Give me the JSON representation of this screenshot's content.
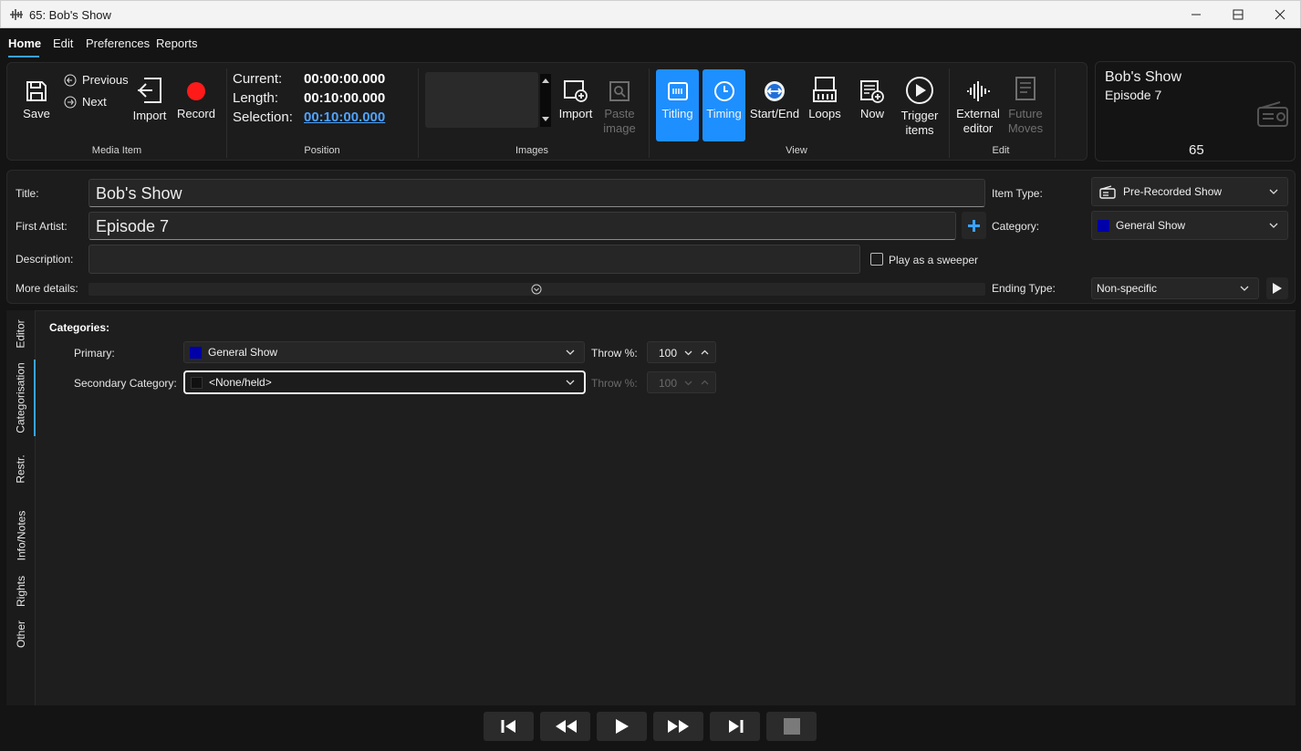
{
  "window": {
    "title": "65: Bob's Show"
  },
  "menu": {
    "items": [
      "Home",
      "Edit",
      "Preferences",
      "Reports"
    ]
  },
  "ribbon": {
    "media_item": {
      "label": "Media Item",
      "save": "Save",
      "previous": "Previous",
      "next": "Next",
      "import": "Import",
      "record": "Record"
    },
    "position": {
      "label": "Position",
      "current_label": "Current:",
      "current": "00:00:00.000",
      "length_label": "Length:",
      "length": "00:10:00.000",
      "selection_label": "Selection:",
      "selection": "00:10:00.000"
    },
    "images": {
      "label": "Images",
      "import": "Import",
      "paste": "Paste image"
    },
    "view": {
      "label": "View",
      "titling": "Titling",
      "timing": "Timing",
      "startend": "Start/End",
      "loops": "Loops",
      "now": "Now",
      "trigger": "Trigger items"
    },
    "edit": {
      "label": "Edit",
      "external_editor": "External editor",
      "future_moves": "Future Moves"
    }
  },
  "info_panel": {
    "title": "Bob's Show",
    "subtitle": "Episode 7",
    "number": "65"
  },
  "details": {
    "title_label": "Title:",
    "title_value": "Bob's Show",
    "artist_label": "First Artist:",
    "artist_value": "Episode 7",
    "description_label": "Description:",
    "description_value": "",
    "more_label": "More details:",
    "sweeper_label": "Play as a sweeper",
    "item_type_label": "Item Type:",
    "item_type_value": "Pre-Recorded Show",
    "category_label": "Category:",
    "category_value": "General Show",
    "ending_label": "Ending Type:",
    "ending_value": "Non-specific"
  },
  "tabs": [
    "Editor",
    "Categorisation",
    "Restr.",
    "Info/Notes",
    "Rights",
    "Other"
  ],
  "categorisation": {
    "title": "Categories:",
    "primary_label": "Primary:",
    "primary_value": "General Show",
    "secondary_label": "Secondary Category:",
    "secondary_value": "<None/held>",
    "throw_label": "Throw %:",
    "throw_primary": "100",
    "throw_secondary": "100"
  },
  "colors": {
    "accent": "#1e8fff",
    "general_show": "#0000a8",
    "record": "#ff1a1a"
  }
}
